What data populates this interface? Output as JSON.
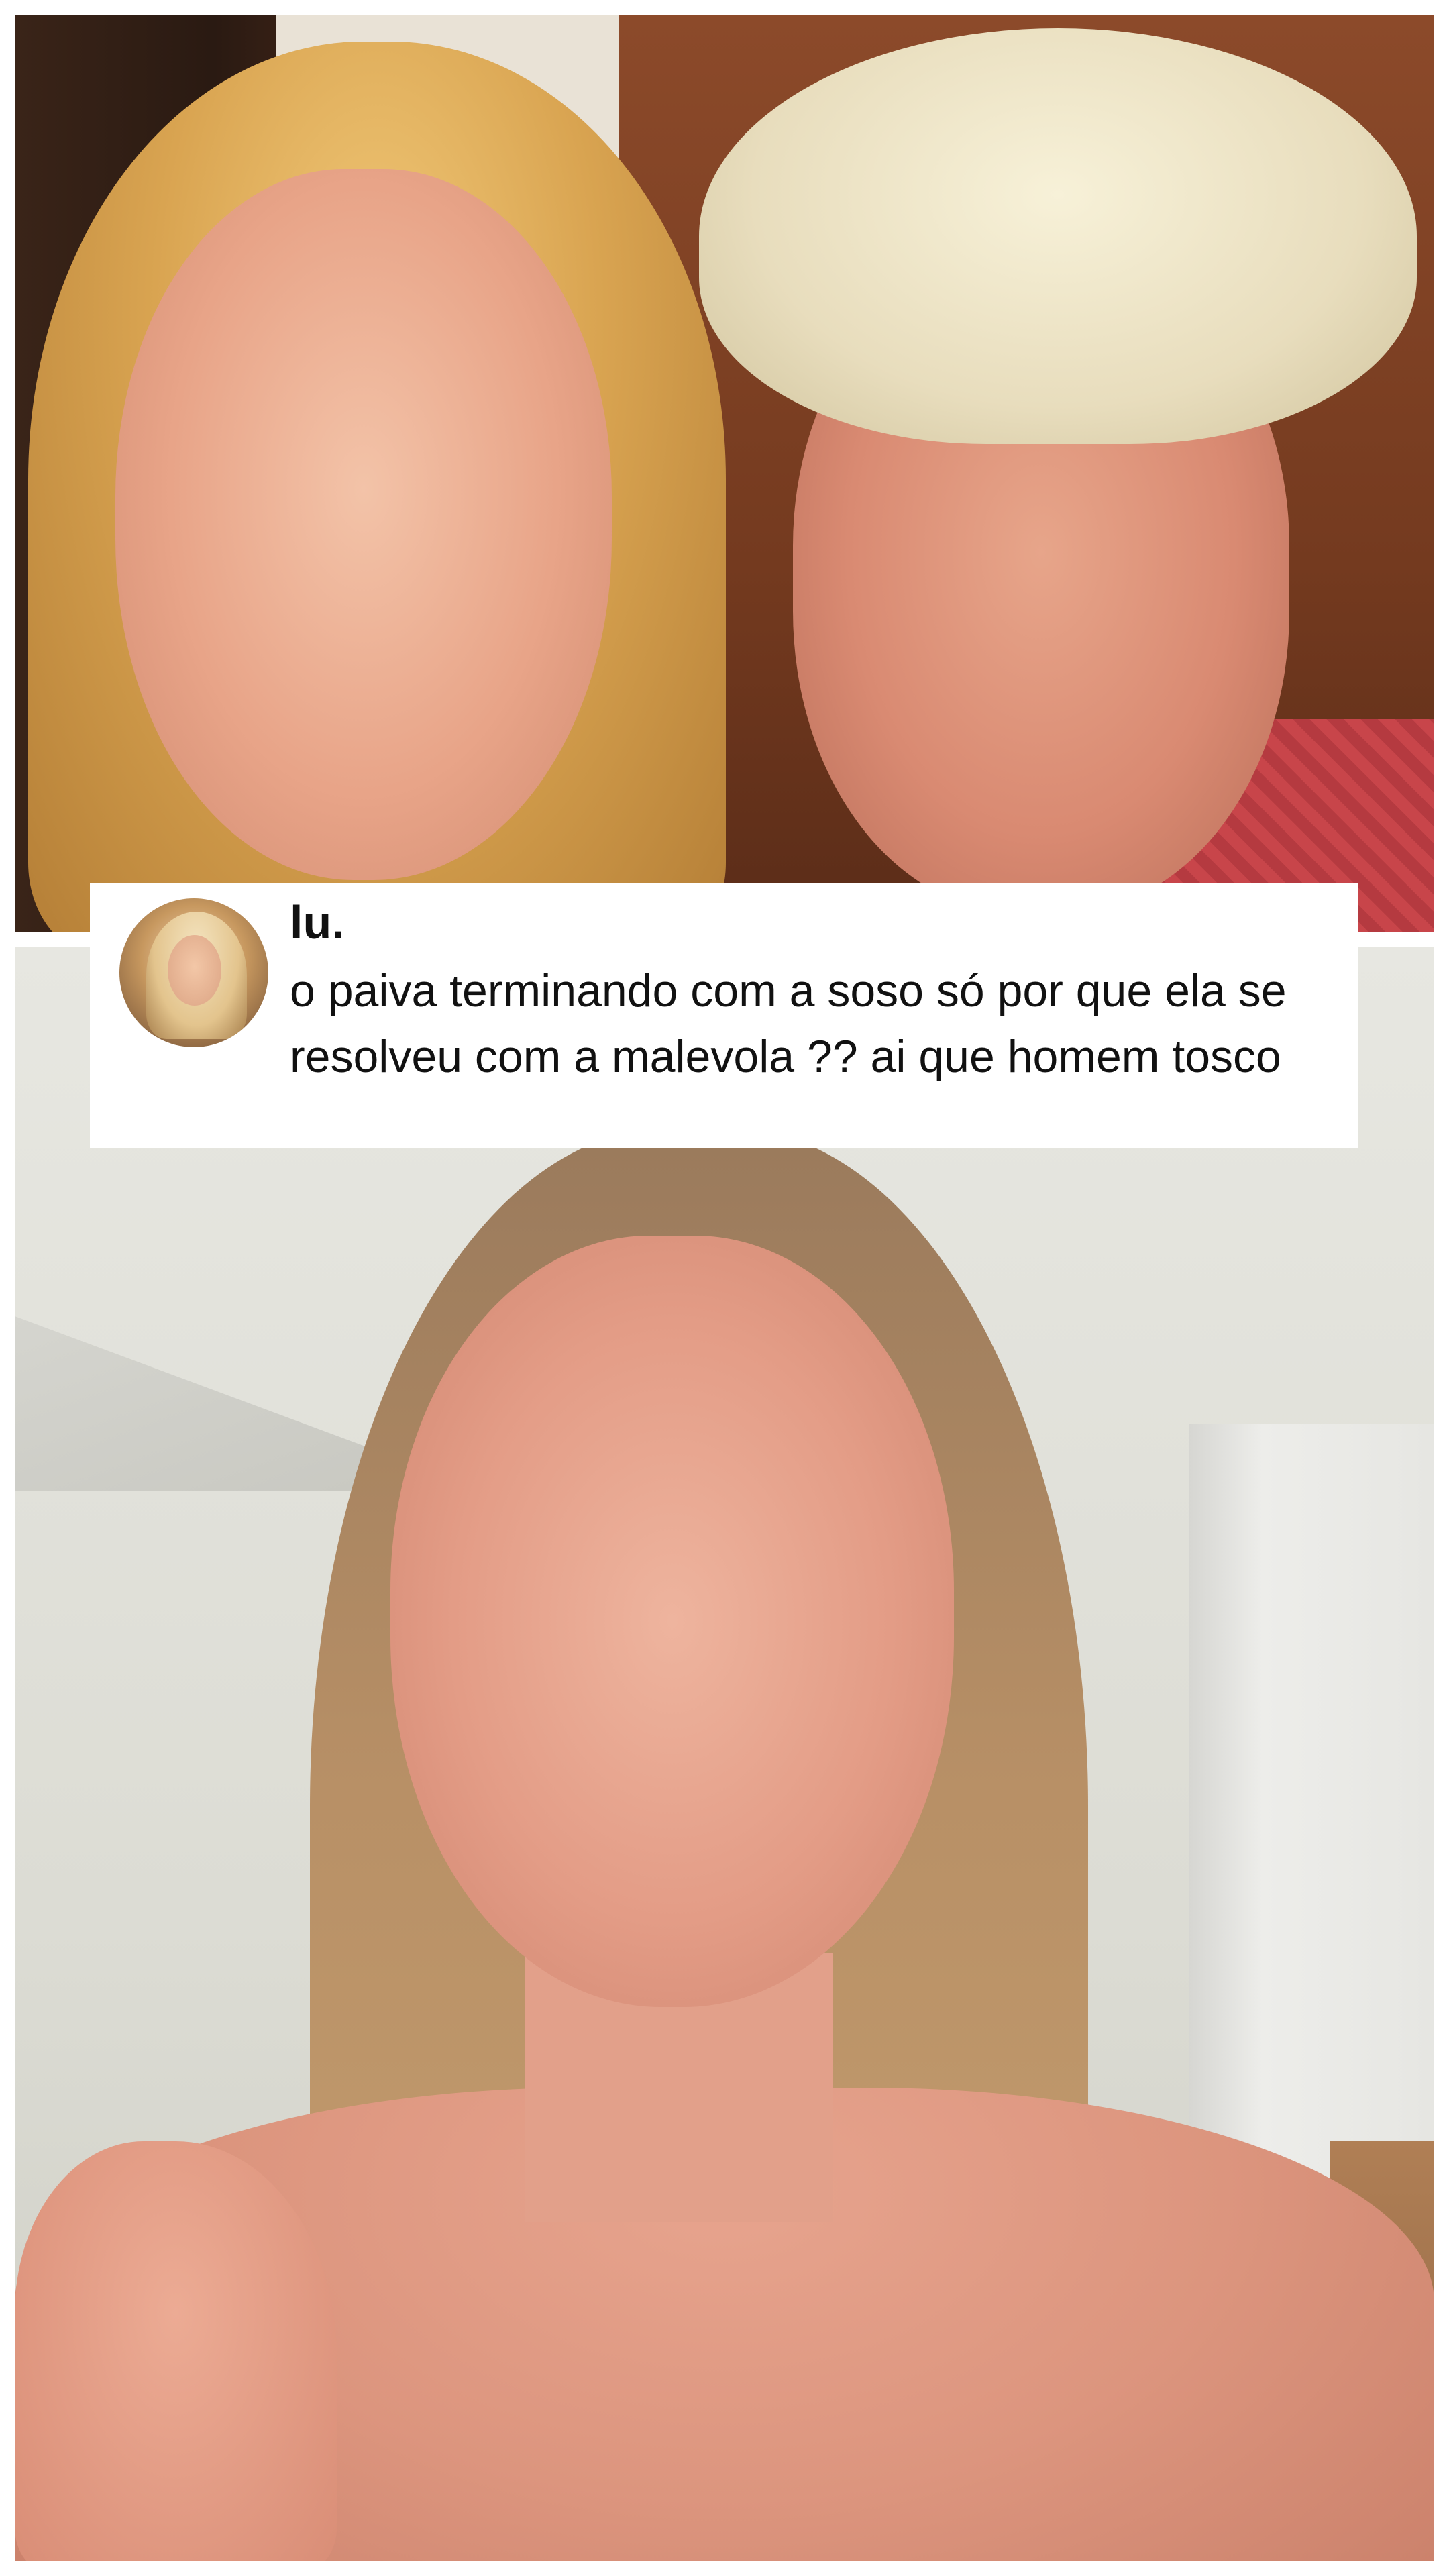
{
  "comment": {
    "username": "lu.",
    "text": "o paiva terminando com a soso só por que ela se resolveu com a malevola ?? ai que homem tosco",
    "avatar_icon": "profile-avatar"
  },
  "colors": {
    "card_background": "#ffffff",
    "text": "#111111"
  }
}
